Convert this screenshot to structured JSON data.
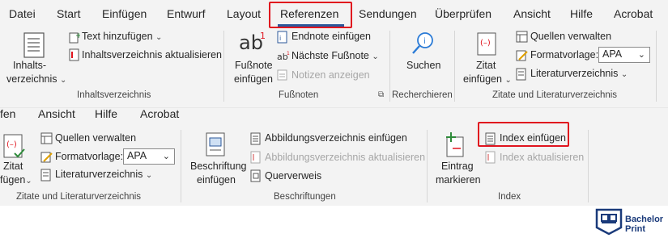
{
  "top": {
    "tabs": [
      "Datei",
      "Start",
      "Einfügen",
      "Entwurf",
      "Layout",
      "Referenzen",
      "Sendungen",
      "Überprüfen",
      "Ansicht",
      "Hilfe",
      "Acrobat"
    ],
    "inhaltsverzeichnis": {
      "big_label_1": "Inhalts-",
      "big_label_2": "verzeichnis",
      "text_hinzufuegen": "Text hinzufügen",
      "aktualisieren": "Inhaltsverzeichnis aktualisieren",
      "group": "Inhaltsverzeichnis"
    },
    "fussnoten": {
      "big_label_1": "Fußnote",
      "big_label_2": "einfügen",
      "endnote": "Endnote einfügen",
      "naechste": "Nächste Fußnote",
      "notizen": "Notizen anzeigen",
      "group": "Fußnoten"
    },
    "recherchieren": {
      "suchen": "Suchen",
      "group": "Recherchieren"
    },
    "zitate": {
      "big_label_1": "Zitat",
      "big_label_2": "einfügen",
      "quellen": "Quellen verwalten",
      "formatvorlage": "Formatvorlage:",
      "formatvorlage_value": "APA",
      "literatur": "Literaturverzeichnis",
      "group": "Zitate und Literaturverzeichnis"
    }
  },
  "bottom": {
    "tabs": [
      "fen",
      "Ansicht",
      "Hilfe",
      "Acrobat"
    ],
    "zitate": {
      "big_label_1": "Zitat",
      "big_label_2": "fügen",
      "quellen": "Quellen verwalten",
      "formatvorlage": "Formatvorlage:",
      "formatvorlage_value": "APA",
      "literatur": "Literaturverzeichnis",
      "group": "Zitate und Literaturverzeichnis"
    },
    "beschriftungen": {
      "big_label_1": "Beschriftung",
      "big_label_2": "einfügen",
      "abbildung": "Abbildungsverzeichnis einfügen",
      "abbildung_akt": "Abbildungsverzeichnis aktualisieren",
      "querverweis": "Querverweis",
      "group": "Beschriftungen"
    },
    "index": {
      "big_label_1": "Eintrag",
      "big_label_2": "markieren",
      "index_einfuegen": "Index einfügen",
      "index_akt": "Index aktualisieren",
      "group": "Index"
    }
  },
  "logo": {
    "line1": "Bachelor",
    "line2": "Print"
  },
  "colors": {
    "ribbon_bg": "#f3f3f3",
    "accent": "#2b579a",
    "highlight_red": "#e0141e",
    "logo_blue": "#1a3a7a"
  }
}
